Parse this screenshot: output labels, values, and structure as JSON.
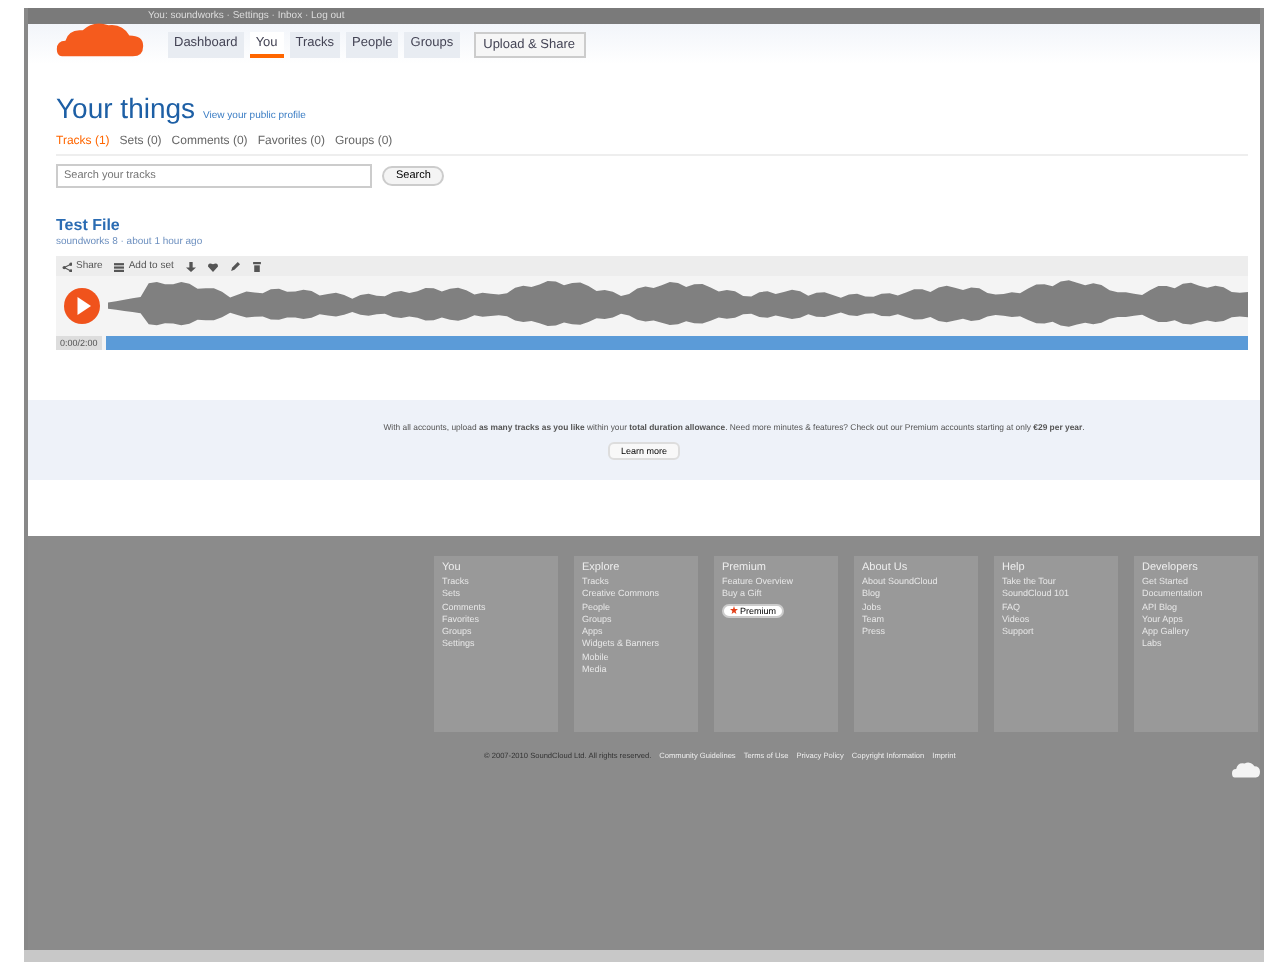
{
  "top_bar": {
    "account_links": "You: soundworks · Settings · Inbox · Log out"
  },
  "nav": {
    "tabs": [
      {
        "label": "Dashboard",
        "selected": false
      },
      {
        "label": "You",
        "selected": true
      },
      {
        "label": "Tracks",
        "selected": false
      },
      {
        "label": "People",
        "selected": false
      },
      {
        "label": "Groups",
        "selected": false
      }
    ],
    "upload_button": "Upload & Share"
  },
  "heading": {
    "title": "Your things",
    "profile_link": "View your public profile"
  },
  "sub_tabs": [
    {
      "label": "Tracks (1)",
      "selected": true
    },
    {
      "label": "Sets (0)",
      "selected": false
    },
    {
      "label": "Comments (0)",
      "selected": false
    },
    {
      "label": "Favorites (0)",
      "selected": false
    },
    {
      "label": "Groups (0)",
      "selected": false
    }
  ],
  "search": {
    "placeholder": "Search your tracks",
    "button": "Search"
  },
  "track": {
    "title": "Test File",
    "meta": "soundworks 8 · about 1 hour ago",
    "toolbar": [
      {
        "kind": "share",
        "label": "Share"
      },
      {
        "kind": "set",
        "label": "Add to set"
      },
      {
        "kind": "download"
      },
      {
        "kind": "favorite"
      },
      {
        "kind": "edit"
      },
      {
        "kind": "delete"
      }
    ],
    "time": "0:00/2:00"
  },
  "info": {
    "text": "With all accounts, upload **as many tracks as you like** within your **total duration allowance**. Need more minutes & features? Check out our Premium accounts starting at only **€29 per year**.",
    "button": "Learn more"
  },
  "footer": {
    "columns": [
      {
        "title": "You",
        "links": [
          "Tracks",
          "Sets",
          "Comments",
          "Favorites",
          "Groups",
          "Settings"
        ]
      },
      {
        "title": "Explore",
        "links": [
          "Tracks",
          "Creative Commons",
          "People",
          "Groups",
          "Apps",
          "Widgets & Banners",
          "Mobile",
          "Media"
        ]
      },
      {
        "title": "Premium",
        "links": [
          "Feature Overview",
          "Buy a Gift"
        ],
        "button": "Premium"
      },
      {
        "title": "About Us",
        "links": [
          "About SoundCloud",
          "Blog",
          "Jobs",
          "Team",
          "Press"
        ]
      },
      {
        "title": "Help",
        "links": [
          "Take the Tour",
          "SoundCloud 101",
          "FAQ",
          "Videos",
          "Support"
        ]
      },
      {
        "title": "Developers",
        "links": [
          "Get Started",
          "Documentation",
          "API Blog",
          "Your Apps",
          "App Gallery",
          "Labs"
        ]
      }
    ],
    "copyright": "© 2007-2010 SoundCloud Ltd. All rights reserved.",
    "links": [
      "Community Guidelines",
      "Terms of Use",
      "Privacy Policy",
      "Copyright Information",
      "Imprint"
    ]
  }
}
